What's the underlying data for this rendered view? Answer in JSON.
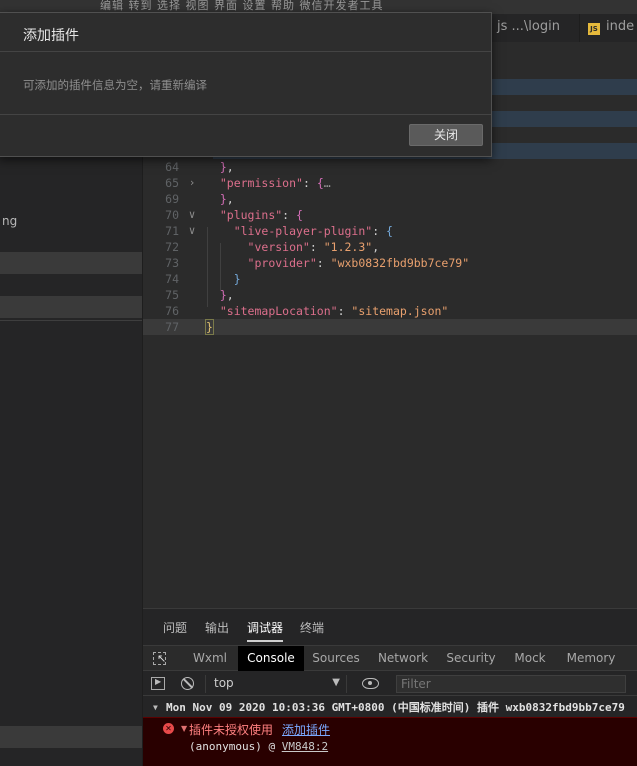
{
  "menubar": {
    "text": "编辑  转到  选择  视图  界面  设置  帮助  微信开发者工具"
  },
  "sidebar": {
    "fragment": "ng"
  },
  "tabs": [
    {
      "icon": "js-icon",
      "label": "js ...\\login"
    },
    {
      "icon": "js-icon",
      "label": "inde"
    }
  ],
  "editor": {
    "lines": [
      {
        "n": "64",
        "parts": [
          [
            "p",
            "  "
          ],
          [
            "b",
            "}"
          ],
          [
            "p",
            ","
          ]
        ]
      },
      {
        "n": "65",
        "fold": ">",
        "parts": [
          [
            "p",
            "  "
          ],
          [
            "k",
            "\"permission\""
          ],
          [
            "p",
            ": "
          ],
          [
            "b",
            "{"
          ],
          [
            "ell",
            "…"
          ]
        ]
      },
      {
        "n": "69",
        "parts": [
          [
            "p",
            "  "
          ],
          [
            "b",
            "}"
          ],
          [
            "p",
            ","
          ]
        ]
      },
      {
        "n": "70",
        "fold": "v",
        "parts": [
          [
            "p",
            "  "
          ],
          [
            "k",
            "\"plugins\""
          ],
          [
            "p",
            ": "
          ],
          [
            "b",
            "{"
          ]
        ]
      },
      {
        "n": "71",
        "fold": "v",
        "parts": [
          [
            "p",
            "    "
          ],
          [
            "k",
            "\"live-player-plugin\""
          ],
          [
            "p",
            ": "
          ],
          [
            "bk",
            "{"
          ]
        ]
      },
      {
        "n": "72",
        "parts": [
          [
            "p",
            "      "
          ],
          [
            "k",
            "\"version\""
          ],
          [
            "p",
            ": "
          ],
          [
            "s",
            "\"1.2.3\""
          ],
          [
            "p",
            ","
          ]
        ]
      },
      {
        "n": "73",
        "parts": [
          [
            "p",
            "      "
          ],
          [
            "k",
            "\"provider\""
          ],
          [
            "p",
            ": "
          ],
          [
            "s",
            "\"wxb0832fbd9bb7ce79\""
          ]
        ]
      },
      {
        "n": "74",
        "parts": [
          [
            "p",
            "    "
          ],
          [
            "bk",
            "}"
          ]
        ]
      },
      {
        "n": "75",
        "parts": [
          [
            "p",
            "  "
          ],
          [
            "b",
            "}"
          ],
          [
            "p",
            ","
          ]
        ]
      },
      {
        "n": "76",
        "parts": [
          [
            "p",
            "  "
          ],
          [
            "k",
            "\"sitemapLocation\""
          ],
          [
            "p",
            ": "
          ],
          [
            "s",
            "\"sitemap.json\""
          ]
        ]
      },
      {
        "n": "77",
        "parts": [
          [
            "bracket",
            "}"
          ]
        ]
      }
    ]
  },
  "dialog": {
    "title": "添加插件",
    "message": "可添加的插件信息为空，请重新编译",
    "close_label": "关闭"
  },
  "panel": {
    "tabs": [
      "问题",
      "输出",
      "调试器",
      "终端"
    ],
    "active_tab": "调试器",
    "devtools_tabs": [
      "Wxml",
      "Console",
      "Sources",
      "Network",
      "Security",
      "Mock",
      "Memory"
    ],
    "active_devtools_tab": "Console",
    "context": "top",
    "filter_placeholder": "Filter",
    "log_group": "Mon Nov 09 2020 10:03:36 GMT+0800 (中国标准时间) 插件 wxb0832fbd9bb7ce79",
    "error_message": "插件未授权使用",
    "error_link": "添加插件",
    "stack_prefix": "(anonymous) @ ",
    "stack_link": "VM848:2"
  }
}
